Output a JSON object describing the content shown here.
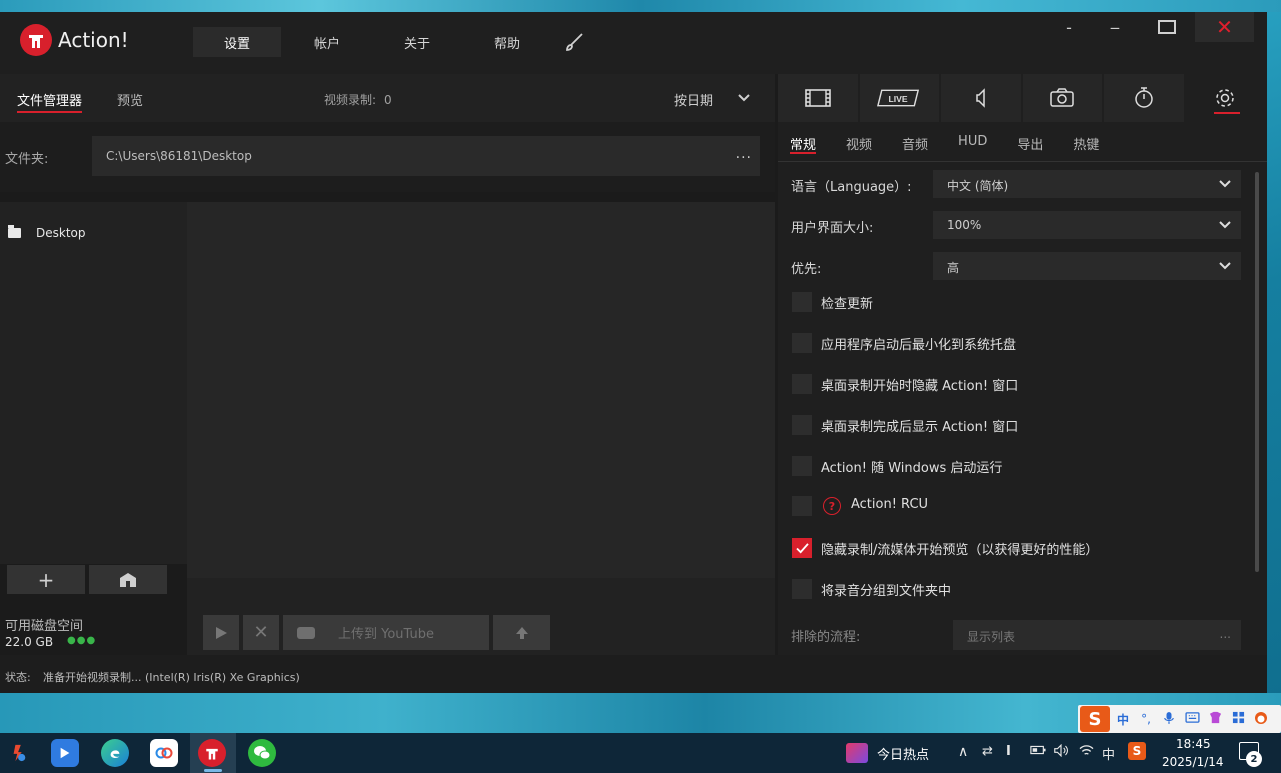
{
  "app": {
    "title": "Action!",
    "nav": [
      "设置",
      "帐户",
      "关于",
      "帮助"
    ],
    "window": {
      "min": "-",
      "restore": "‒",
      "close": "✕"
    }
  },
  "left": {
    "tabs": [
      "文件管理器",
      "预览"
    ],
    "rec_label": "视频录制:",
    "rec_count": "0",
    "sort_label": "按日期",
    "folder_label": "文件夹:",
    "folder_path": "C:\\Users\\86181\\Desktop",
    "folder_more": "...",
    "tree_item": "Desktop",
    "disk_label": "可用磁盘空间",
    "disk_value": "22.0 GB",
    "upload_label": "上传到 YouTube"
  },
  "status": {
    "label": "状态:",
    "value": "准备开始视频录制... (Intel(R) Iris(R) Xe Graphics)"
  },
  "right": {
    "icon_tabs": [
      "film-icon",
      "live-icon",
      "audio-icon",
      "camera-icon",
      "timer-icon",
      "gear-icon"
    ],
    "live_text": "LIVE",
    "subtabs": [
      "常规",
      "视频",
      "音频",
      "HUD",
      "导出",
      "热键"
    ],
    "settings": {
      "language_label": "语言（Language）:",
      "language_value": "中文 (简体)",
      "ui_size_label": "用户界面大小:",
      "ui_size_value": "100%",
      "priority_label": "优先:",
      "priority_value": "高",
      "checks": [
        {
          "label": "检查更新",
          "checked": false
        },
        {
          "label": "应用程序启动后最小化到系统托盘",
          "checked": false
        },
        {
          "label": "桌面录制开始时隐藏 Action! 窗口",
          "checked": false
        },
        {
          "label": "桌面录制完成后显示 Action! 窗口",
          "checked": false
        },
        {
          "label": "Action! 随 Windows 启动运行",
          "checked": false
        },
        {
          "label": "Action! RCU",
          "checked": false
        },
        {
          "label": "隐藏录制/流媒体开始预览（以获得更好的性能）",
          "checked": true
        },
        {
          "label": "将录音分组到文件夹中",
          "checked": false
        }
      ],
      "exclude_label": "排除的流程:",
      "exclude_button": "显示列表",
      "exclude_more": "..."
    }
  },
  "ime": {
    "logo": "S",
    "mode": "中",
    "punct": "°,"
  },
  "taskbar": {
    "news": "今日热点",
    "lang": "中",
    "time": "18:45",
    "date": "2025/1/14",
    "notifications": "2"
  },
  "colors": {
    "accent": "#d8202c",
    "bg": "#1b1b1b",
    "panel": "#222222",
    "green": "#39b54a"
  }
}
